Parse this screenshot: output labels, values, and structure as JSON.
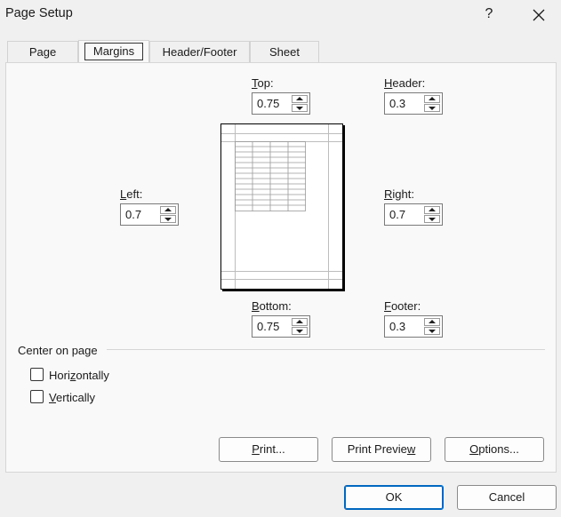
{
  "window": {
    "title": "Page Setup",
    "help": "?"
  },
  "tabs": [
    {
      "label": "Page"
    },
    {
      "label": "Margins"
    },
    {
      "label": "Header/Footer"
    },
    {
      "label": "Sheet"
    }
  ],
  "margins": {
    "top": {
      "label_u": "T",
      "label_rest": "op:",
      "value": "0.75"
    },
    "header": {
      "label_u": "H",
      "label_rest": "eader:",
      "value": "0.3"
    },
    "left": {
      "label_u": "L",
      "label_rest": "eft:",
      "value": "0.7"
    },
    "right": {
      "label_u": "R",
      "label_rest": "ight:",
      "value": "0.7"
    },
    "bottom": {
      "label_u": "B",
      "label_rest": "ottom:",
      "value": "0.75"
    },
    "footer": {
      "label_u": "F",
      "label_rest": "ooter:",
      "value": "0.3"
    }
  },
  "center": {
    "title": "Center on page",
    "horizontally": {
      "pre": "Hori",
      "u": "z",
      "post": "ontally",
      "checked": false
    },
    "vertically": {
      "pre": "",
      "u": "V",
      "post": "ertically",
      "checked": false
    }
  },
  "buttons": {
    "print": {
      "pre": "",
      "u": "P",
      "post": "rint..."
    },
    "print_preview": {
      "pre": "Print Previe",
      "u": "w",
      "post": ""
    },
    "options": {
      "pre": "",
      "u": "O",
      "post": "ptions..."
    },
    "ok": "OK",
    "cancel": "Cancel"
  }
}
